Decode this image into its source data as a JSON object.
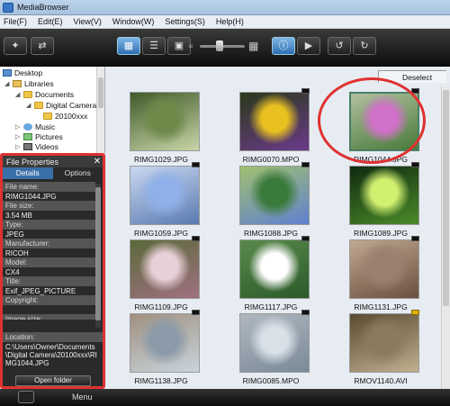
{
  "window": {
    "title": "MediaBrowser"
  },
  "menu": [
    "File(F)",
    "Edit(E)",
    "View(V)",
    "Window(W)",
    "Settings(S)",
    "Help(H)"
  ],
  "tree": [
    {
      "label": "Desktop",
      "icon": "desktop-icon"
    },
    {
      "label": "Libraries",
      "icon": "library-icon"
    },
    {
      "label": "Documents",
      "icon": "folder-icon"
    },
    {
      "label": "Digital Camera",
      "icon": "folder-icon"
    },
    {
      "label": "20100xxx",
      "icon": "folder-icon"
    },
    {
      "label": "Music",
      "icon": "music-icon"
    },
    {
      "label": "Pictures",
      "icon": "pictures-icon"
    },
    {
      "label": "Videos",
      "icon": "videos-icon"
    }
  ],
  "properties": {
    "title": "File Properties",
    "tabs": [
      "Details",
      "Options"
    ],
    "rows": [
      {
        "label": "File name:",
        "value": "RIMG1044.JPG"
      },
      {
        "label": "File size:",
        "value": "3.54 MB"
      },
      {
        "label": "Type:",
        "value": "JPEG"
      },
      {
        "label": "Manufacturer:",
        "value": "RICOH"
      },
      {
        "label": "Model:",
        "value": "CX4"
      },
      {
        "label": "Title:",
        "value": "Exif_JPEG_PICTURE"
      },
      {
        "label": "Copyright:",
        "value": ""
      }
    ],
    "image_size_label": "Image size:",
    "location_label": "Location:",
    "location_value": "C:\\Users\\Owner\\Documents\\Digital Camera\\20100xxx\\RIMG1044.JPG",
    "open_folder": "Open folder"
  },
  "grid": {
    "deselect": "Deselect",
    "items": [
      {
        "name": "RIMG1029.JPG",
        "colors": [
          "#6d8a4a",
          "#c9d6a8",
          "#3f5a2a"
        ],
        "badge": false
      },
      {
        "name": "RIMG0070.MPO",
        "colors": [
          "#e8c020",
          "#6a3a8a",
          "#2a3a1a"
        ],
        "badge": true
      },
      {
        "name": "RIMG1044.JPG",
        "colors": [
          "#d070c8",
          "#4a7a3a",
          "#b0c0a0"
        ],
        "badge": true
      },
      {
        "name": "RIMG1059.JPG",
        "colors": [
          "#8fb0e8",
          "#5a7ab0",
          "#cad8f0"
        ],
        "badge": true
      },
      {
        "name": "RIMG1088.JPG",
        "colors": [
          "#3a7a3a",
          "#6080d0",
          "#a0c070"
        ],
        "badge": true
      },
      {
        "name": "RIMG1089.JPG",
        "colors": [
          "#d0f070",
          "#4a8a2a",
          "#102a10"
        ],
        "badge": true
      },
      {
        "name": "RIMG1109.JPG",
        "colors": [
          "#e8d0d8",
          "#a07080",
          "#5a6a3a"
        ],
        "badge": true
      },
      {
        "name": "RIMG1117.JPG",
        "colors": [
          "#ffffff",
          "#2a5a2a",
          "#5a8a4a"
        ],
        "badge": true
      },
      {
        "name": "RIMG1131.JPG",
        "colors": [
          "#9a8070",
          "#6a5040",
          "#c0a890"
        ],
        "badge": true
      },
      {
        "name": "RIMG1138.JPG",
        "colors": [
          "#8a9aa8",
          "#c8d4dc",
          "#a09080"
        ],
        "badge": true
      },
      {
        "name": "RIMG0085.MPO",
        "colors": [
          "#d8e0e8",
          "#7a8a98",
          "#b0b8c0"
        ],
        "badge": true
      },
      {
        "name": "RMOV1140.AVI",
        "colors": [
          "#8a7a60",
          "#c0b090",
          "#5a4a30"
        ],
        "badge": true,
        "badge_color": "yellow"
      }
    ]
  },
  "bottom": {
    "menu_label": "Menu"
  }
}
